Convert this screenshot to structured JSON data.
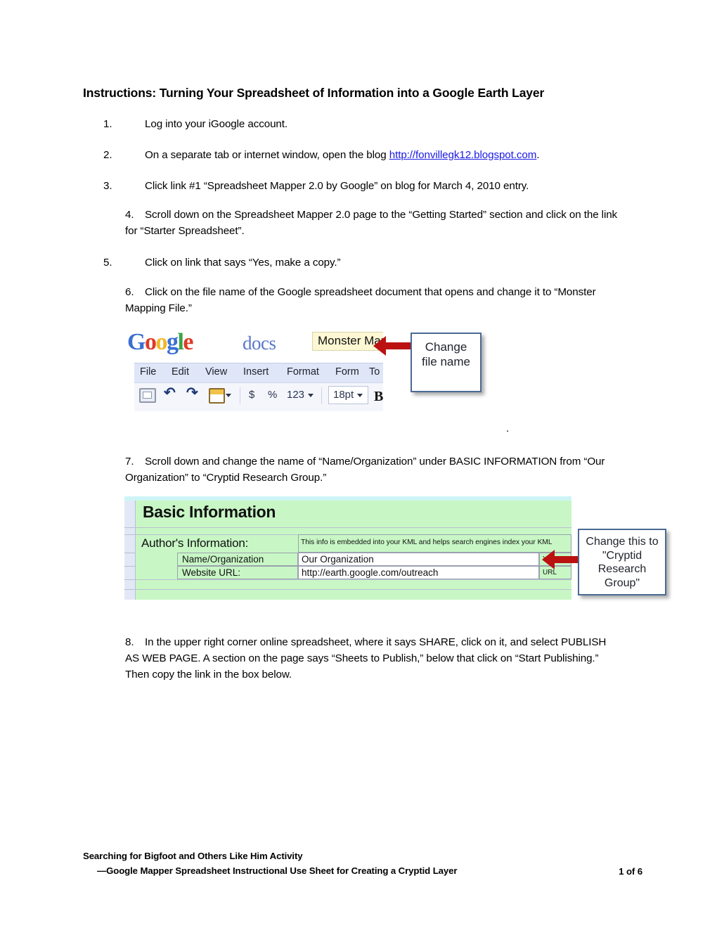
{
  "document": {
    "title": "Instructions: Turning Your Spreadsheet of Information into a Google Earth Layer",
    "steps": [
      {
        "num": "1.",
        "text": "Log into your iGoogle account."
      },
      {
        "num": "2.",
        "text_before": "On a separate tab or internet window, open the blog ",
        "link": "http://fonvillegk12.blogspot.com",
        "text_after": "."
      },
      {
        "num": "3.",
        "text": "Click link #1 “Spreadsheet Mapper 2.0 by Google” on blog for March 4, 2010 entry."
      },
      {
        "num": "4.",
        "text": "Scroll down on the Spreadsheet Mapper 2.0 page to the “Getting Started” section and click on the link for “Starter Spreadsheet”."
      },
      {
        "num": "5.",
        "text": "Click on link that says “Yes, make a copy.”"
      },
      {
        "num": "6.",
        "text": "Click on the file name of the Google spreadsheet document that opens and change it to “Monster Mapping File.”"
      },
      {
        "num": "7.",
        "text": "Scroll down and change the name of “Name/Organization” under BASIC INFORMATION from “Our Organization” to “Cryptid Research Group.”"
      },
      {
        "num": "8.",
        "text": "In the upper right corner online spreadsheet, where it says SHARE, click on it, and select PUBLISH AS WEB PAGE. A section on the page says “Sheets to Publish,” below that click on “Start Publishing.” Then copy the link in the box below."
      }
    ],
    "stray_period": "."
  },
  "screenshot_google_docs": {
    "logo": {
      "g1": "G",
      "o1": "o",
      "o2": "o",
      "g2": "g",
      "l": "l",
      "e": "e"
    },
    "logo_colors": {
      "blue": "#3c6fd1",
      "red": "#dd3b27",
      "yellow": "#f2b825",
      "green": "#3aa544"
    },
    "docs_word": "docs",
    "filename_value": "Monster Mapping File",
    "menu_items": [
      "File",
      "Edit",
      "View",
      "Insert",
      "Format",
      "Form",
      "To"
    ],
    "toolbar": {
      "print_icon": "printer-icon",
      "undo_icon": "undo-arrow-icon",
      "redo_icon": "redo-arrow-icon",
      "paint_format_icon": "paint-format-icon",
      "currency_label": "$",
      "percent_label": "%",
      "number_format_label": "123",
      "font_size_value": "18pt",
      "bold_label": "B"
    },
    "callout": {
      "line1": "Change",
      "line2": "file name"
    }
  },
  "screenshot_basic_information": {
    "sheet_title": "Basic Information",
    "author_section_label": "Author's Information:",
    "info_note": "This info is embedded into your KML and helps search engines index your KML",
    "rows": [
      {
        "label": "Name/Organization",
        "value": "Our Organization",
        "tag": "You"
      },
      {
        "label": "Website URL:",
        "value": "http://earth.google.com/outreach",
        "tag": "URL"
      }
    ],
    "colors": {
      "sheet_green": "#c8f7c5",
      "row_header": "#e3e8f6",
      "top_strip": "#cdf5f6"
    },
    "callout": {
      "line1": "Change this to",
      "line2": "\"Cryptid",
      "line3": "Research",
      "line4": "Group\""
    }
  },
  "footer": {
    "line1": "Searching for Bigfoot and Others Like Him Activity",
    "line2": "—Google Mapper Spreadsheet Instructional Use Sheet for Creating a Cryptid Layer",
    "page": "1 of 6"
  }
}
